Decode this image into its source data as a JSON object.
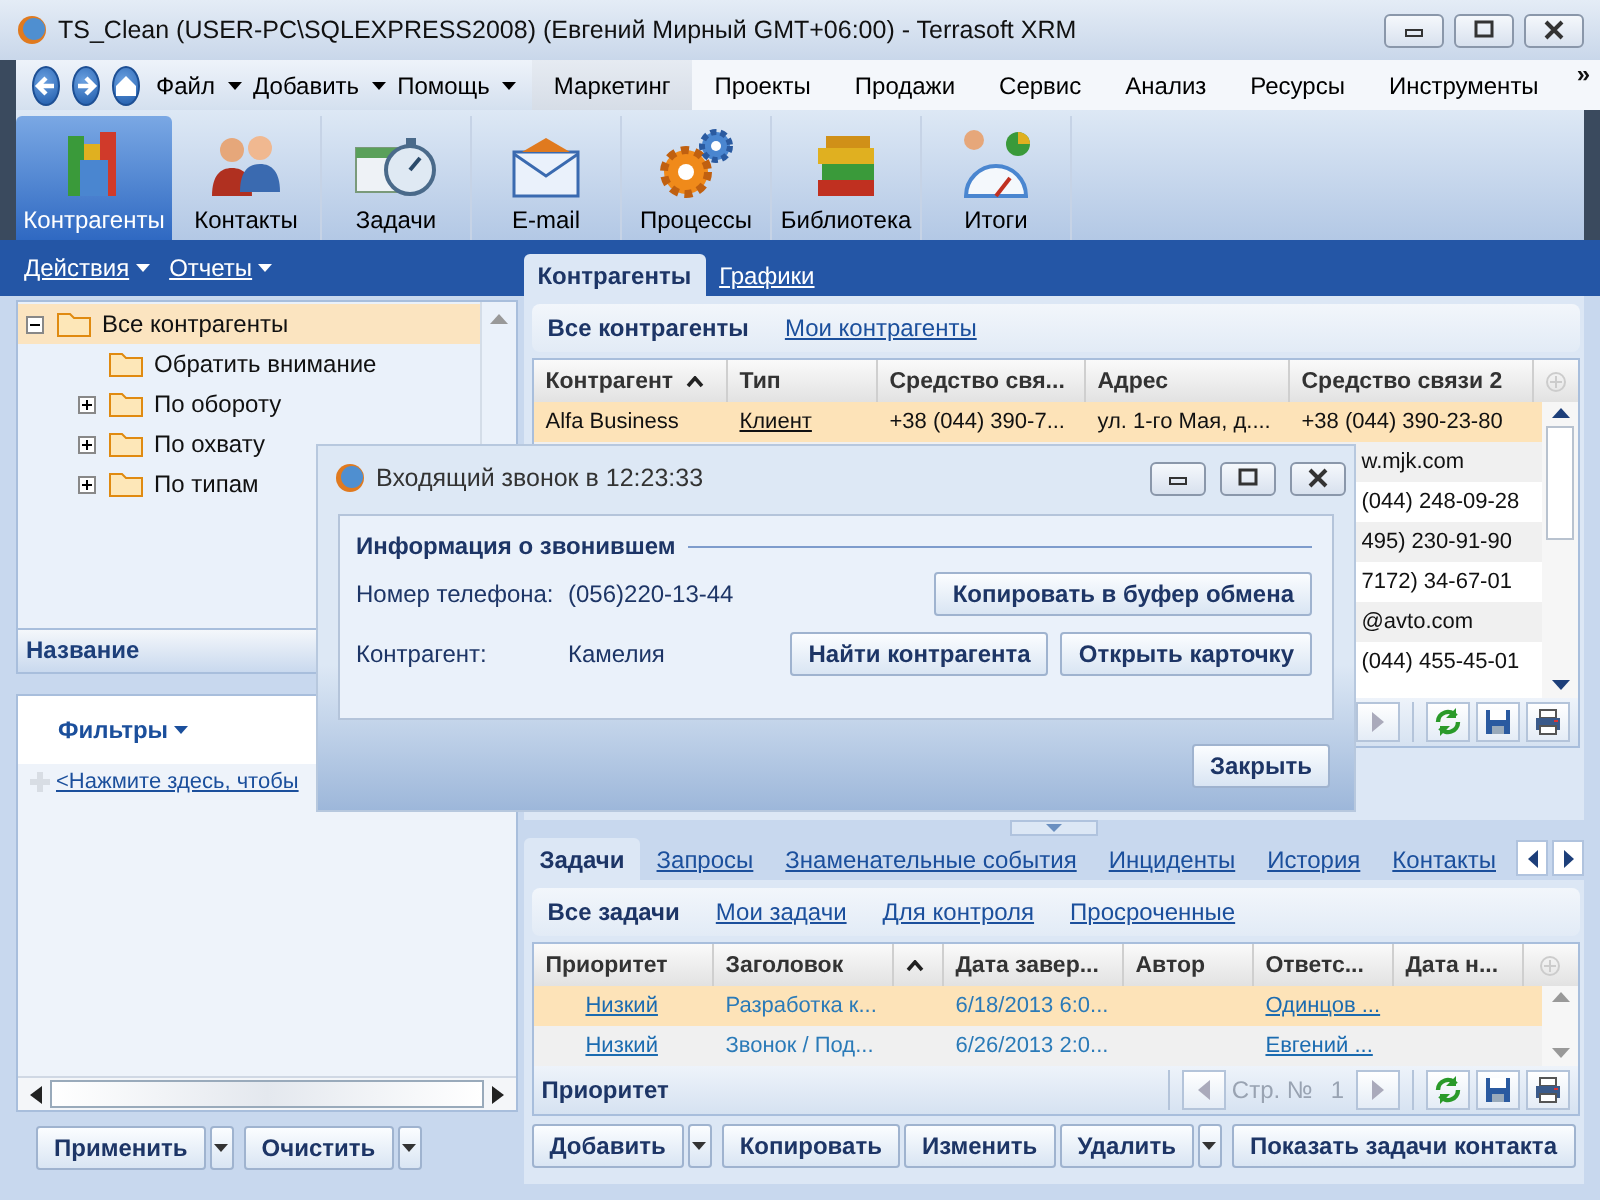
{
  "window": {
    "title": "TS_Clean (USER-PC\\SQLEXPRESS2008) (Евгений Мирный GMT+06:00) - Terrasoft XRM"
  },
  "menu": {
    "dropdowns": [
      "Файл",
      "Добавить",
      "Помощь"
    ],
    "sections": [
      {
        "label": "Маркетинг",
        "selected": true
      },
      {
        "label": "Проекты",
        "selected": false
      },
      {
        "label": "Продажи",
        "selected": false
      },
      {
        "label": "Сервис",
        "selected": false
      },
      {
        "label": "Анализ",
        "selected": false
      },
      {
        "label": "Ресурсы",
        "selected": false
      },
      {
        "label": "Инструменты",
        "selected": false
      }
    ],
    "overflow": "»"
  },
  "modules": [
    {
      "label": "Контрагенты",
      "selected": true
    },
    {
      "label": "Контакты",
      "selected": false
    },
    {
      "label": "Задачи",
      "selected": false
    },
    {
      "label": "E-mail",
      "selected": false
    },
    {
      "label": "Процессы",
      "selected": false
    },
    {
      "label": "Библиотека",
      "selected": false
    },
    {
      "label": "Итоги",
      "selected": false
    }
  ],
  "left": {
    "actions": [
      "Действия",
      "Отчеты"
    ],
    "tree": [
      {
        "label": "Все контрагенты",
        "selected": true,
        "expanded": true,
        "children": [
          {
            "label": "Обратить внимание",
            "selected": false
          },
          {
            "label": "По обороту",
            "selected": false,
            "expanded": false
          },
          {
            "label": "По охвату",
            "selected": false,
            "expanded": false
          },
          {
            "label": "По типам",
            "selected": false,
            "expanded": false
          }
        ]
      }
    ],
    "column_header": "Название",
    "filters": {
      "title": "Фильтры",
      "link": "<Нажмите здесь, чтобы"
    },
    "buttons": [
      {
        "label": "Применить",
        "dropdown": true
      },
      {
        "label": "Очистить",
        "dropdown": true
      }
    ]
  },
  "main": {
    "tabs": [
      {
        "label": "Контрагенты",
        "selected": true
      },
      {
        "label": "Графики",
        "selected": false
      }
    ],
    "views": [
      {
        "label": "Все контрагенты",
        "selected": true
      },
      {
        "label": "Мои контрагенты",
        "selected": false
      }
    ],
    "grid": {
      "columns": [
        {
          "label": "Контрагент",
          "sorted": true
        },
        {
          "label": "Тип",
          "sorted": false
        },
        {
          "label": "Средство свя...",
          "sorted": false
        },
        {
          "label": "Адрес",
          "sorted": false
        },
        {
          "label": "Средство связи 2",
          "sorted": false
        }
      ],
      "rows": [
        {
          "selected": true,
          "cells": [
            {
              "text": "Alfa Business",
              "kind": "text"
            },
            {
              "text": "Клиент",
              "kind": "link"
            },
            {
              "text": "+38 (044) 390-7...",
              "kind": "text"
            },
            {
              "text": "ул. 1-го Мая, д....",
              "kind": "text"
            },
            {
              "text": "+38 (044) 390-23-80",
              "kind": "text"
            }
          ]
        }
      ],
      "covered_rows": [
        "w.mjk.com",
        "(044) 248-09-28",
        "495) 230-91-90",
        "7172) 34-67-01",
        "@avto.com",
        "(044) 455-45-01"
      ]
    }
  },
  "dialog": {
    "title": "Входящий звонок в 12:23:33",
    "section": "Информация о звонившем",
    "fields": [
      {
        "label": "Номер телефона:",
        "value": "(056)220-13-44"
      },
      {
        "label": "Контрагент:",
        "value": "Камелия"
      }
    ],
    "buttons": [
      "Копировать в буфер обмена",
      "Найти контрагента",
      "Открыть карточку"
    ],
    "close": "Закрыть"
  },
  "detail": {
    "tabs": [
      {
        "label": "Задачи",
        "selected": true
      },
      {
        "label": "Запросы",
        "selected": false
      },
      {
        "label": "Знаменательные события",
        "selected": false
      },
      {
        "label": "Инциденты",
        "selected": false
      },
      {
        "label": "История",
        "selected": false
      },
      {
        "label": "Контакты",
        "selected": false
      }
    ],
    "views": [
      {
        "label": "Все задачи",
        "selected": true
      },
      {
        "label": "Мои задачи",
        "selected": false
      },
      {
        "label": "Для контроля",
        "selected": false
      },
      {
        "label": "Просроченные",
        "selected": false
      }
    ],
    "grid": {
      "columns": [
        {
          "label": "Приоритет",
          "sorted": false
        },
        {
          "label": "Заголовок",
          "sorted": false
        },
        {
          "sorted": true
        },
        {
          "label": "Дата завер...",
          "sorted": false
        },
        {
          "label": "Автор",
          "sorted": false
        },
        {
          "label": "Ответс...",
          "sorted": false
        },
        {
          "label": "Дата н...",
          "sorted": false
        }
      ],
      "rows": [
        {
          "selected": true,
          "priority": "Низкий",
          "title": "Разработка к...",
          "due": "6/18/2013 6:0...",
          "owner": "Одинцов ..."
        },
        {
          "selected": false,
          "priority": "Низкий",
          "title": "Звонок / Под...",
          "due": "6/26/2013 2:0...",
          "owner": "Евгений ..."
        }
      ],
      "group_by": "Приоритет",
      "page_label": "Стр. №",
      "page": "1"
    },
    "buttons": [
      {
        "label": "Добавить",
        "dropdown": true
      },
      {
        "label": "Копировать",
        "dropdown": false
      },
      {
        "label": "Изменить",
        "dropdown": false
      },
      {
        "label": "Удалить",
        "dropdown": true
      },
      {
        "label": "Показать задачи контакта",
        "dropdown": false
      }
    ]
  }
}
